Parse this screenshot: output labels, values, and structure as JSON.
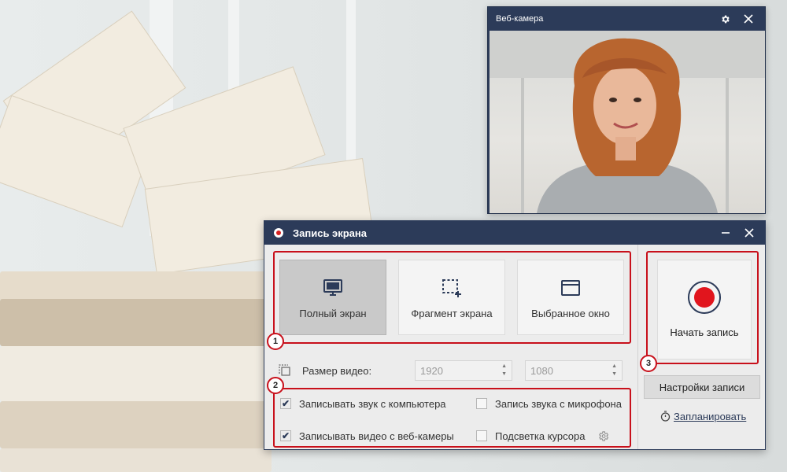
{
  "webcam_window": {
    "title": "Веб-камера"
  },
  "recorder_window": {
    "title": "Запись экрана",
    "modes": [
      {
        "label": "Полный экран",
        "icon": "monitor-icon",
        "active": true
      },
      {
        "label": "Фрагмент экрана",
        "icon": "region-select-icon",
        "active": false
      },
      {
        "label": "Выбранное окно",
        "icon": "window-icon",
        "active": false
      }
    ],
    "video_size": {
      "label": "Размер видео:",
      "width": "1920",
      "height": "1080"
    },
    "options": [
      {
        "label": "Записывать звук с компьютера",
        "checked": true
      },
      {
        "label": "Запись звука с микрофона",
        "checked": false
      },
      {
        "label": "Записывать видео с веб-камеры",
        "checked": true
      },
      {
        "label": "Подсветка курсора",
        "checked": false
      }
    ],
    "start_button_label": "Начать запись",
    "settings_button_label": "Настройки записи",
    "schedule_link_label": "Запланировать",
    "badges": [
      "1",
      "2",
      "3"
    ]
  },
  "colors": {
    "titlebar": "#2c3b59",
    "highlight": "#c8101b",
    "record_red": "#e1151d"
  }
}
